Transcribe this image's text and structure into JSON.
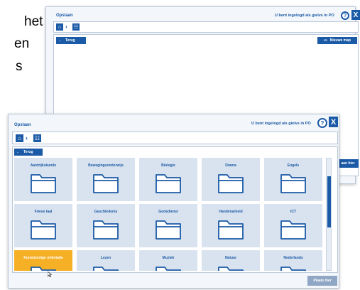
{
  "document": {
    "line1": "het",
    "line2": "en",
    "line3": "s"
  },
  "back_dialog": {
    "title": "Opslaan",
    "login_status": "U bent ingelogd als gielvs in PO",
    "help_label": "?",
    "close_label": "X",
    "back_label": "Terug",
    "new_folder_label": "Nieuwe map",
    "partial_button_label": "aan hier"
  },
  "front_dialog": {
    "title": "Opslaan",
    "login_status": "U bent ingelogd als gielvs in PO",
    "help_label": "?",
    "close_label": "X",
    "back_label": "Terug",
    "save_label": "Plaats hier",
    "folders": [
      {
        "label": "Aardrijkskunde",
        "selected": false
      },
      {
        "label": "Bewegingsonderwijs",
        "selected": false
      },
      {
        "label": "Biologie",
        "selected": false
      },
      {
        "label": "Drama",
        "selected": false
      },
      {
        "label": "Engels",
        "selected": false
      },
      {
        "label": "Friese taal",
        "selected": false
      },
      {
        "label": "Geschiedenis",
        "selected": false
      },
      {
        "label": "Godsdienst",
        "selected": false
      },
      {
        "label": "Handenarbeid",
        "selected": false
      },
      {
        "label": "ICT",
        "selected": false
      },
      {
        "label": "Kunstzinnige oriëntatie",
        "selected": true
      },
      {
        "label": "Lezen",
        "selected": false
      },
      {
        "label": "Muziek",
        "selected": false
      },
      {
        "label": "Natuur",
        "selected": false
      },
      {
        "label": "Nederlands",
        "selected": false
      }
    ]
  },
  "colors": {
    "accent": "#1b5aa6",
    "tile": "#d9e3ef",
    "selected": "#f5b025"
  }
}
